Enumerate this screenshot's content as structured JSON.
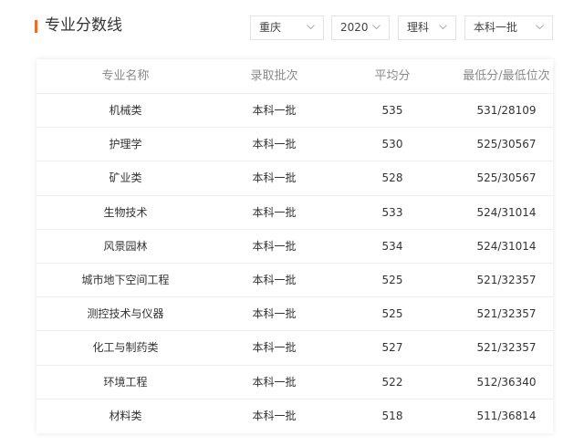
{
  "header": {
    "title": "专业分数线",
    "filters": {
      "province": "重庆",
      "year": "2020",
      "subject": "理科",
      "batch": "本科一批"
    }
  },
  "table": {
    "columns": [
      "专业名称",
      "录取批次",
      "平均分",
      "最低分/最低位次"
    ],
    "rows": [
      {
        "major": "机械类",
        "batch": "本科一批",
        "avg": "535",
        "min": "531/28109"
      },
      {
        "major": "护理学",
        "batch": "本科一批",
        "avg": "530",
        "min": "525/30567"
      },
      {
        "major": "矿业类",
        "batch": "本科一批",
        "avg": "528",
        "min": "525/30567"
      },
      {
        "major": "生物技术",
        "batch": "本科一批",
        "avg": "533",
        "min": "524/31014"
      },
      {
        "major": "风景园林",
        "batch": "本科一批",
        "avg": "534",
        "min": "524/31014"
      },
      {
        "major": "城市地下空间工程",
        "batch": "本科一批",
        "avg": "525",
        "min": "521/32357"
      },
      {
        "major": "测控技术与仪器",
        "batch": "本科一批",
        "avg": "525",
        "min": "521/32357"
      },
      {
        "major": "化工与制药类",
        "batch": "本科一批",
        "avg": "527",
        "min": "521/32357"
      },
      {
        "major": "环境工程",
        "batch": "本科一批",
        "avg": "522",
        "min": "512/36340"
      },
      {
        "major": "材料类",
        "batch": "本科一批",
        "avg": "518",
        "min": "511/36814"
      }
    ]
  },
  "colors": {
    "accent": "#f06b2a",
    "header_text": "#8a8a8a",
    "body_text": "#333333",
    "border": "#e3e3e3"
  },
  "icons": {
    "dropdown": "chevron-down-icon"
  }
}
